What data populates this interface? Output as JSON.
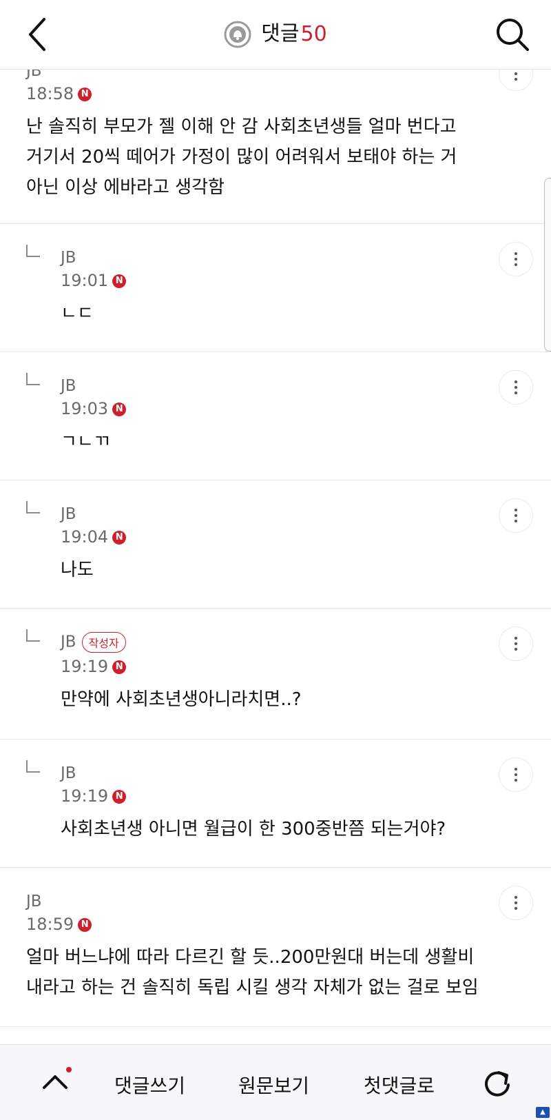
{
  "header": {
    "title": "댓글",
    "count": "50"
  },
  "comments": [
    {
      "author": "JB",
      "time": "18:58",
      "new_badge": "N",
      "text": "난 솔직히 부모가 젤 이해 안 감 사회초년생들 얼마 번다고\n거기서 20씩 떼어가 가정이 많이 어려워서 보태야 하는 거\n아닌 이상 에바라고 생각함"
    },
    {
      "author": "JB",
      "time": "19:01",
      "new_badge": "N",
      "text": "ㄴㄷ"
    },
    {
      "author": "JB",
      "time": "19:03",
      "new_badge": "N",
      "text": "ㄱㄴㄲ"
    },
    {
      "author": "JB",
      "time": "19:04",
      "new_badge": "N",
      "text": "나도"
    },
    {
      "author": "JB",
      "author_badge": "작성자",
      "time": "19:19",
      "new_badge": "N",
      "text": "만약에 사회초년생아니라치면..?"
    },
    {
      "author": "JB",
      "time": "19:19",
      "new_badge": "N",
      "text": "사회초년생 아니면 월급이 한 300중반쯤 되는거야?"
    },
    {
      "author": "JB",
      "time": "18:59",
      "new_badge": "N",
      "text": "얼마 버느냐에 따라 다르긴 할 듯..200만원대 버는데 생활비\n내라고 하는 건 솔직히 독립 시킬 생각 자체가 없는 걸로 보임"
    }
  ],
  "bottom_bar": {
    "write_label": "댓글쓰기",
    "original_label": "원문보기",
    "first_comment_label": "첫댓글로"
  },
  "colors": {
    "accent": "#d01f2a",
    "muted": "#6a6a6a",
    "divider": "#e6e6e6"
  },
  "icons": [
    "back-arrow-icon",
    "bell-icon",
    "search-icon",
    "more-icon",
    "reply-indicator-icon",
    "chevron-up-icon",
    "refresh-icon"
  ]
}
